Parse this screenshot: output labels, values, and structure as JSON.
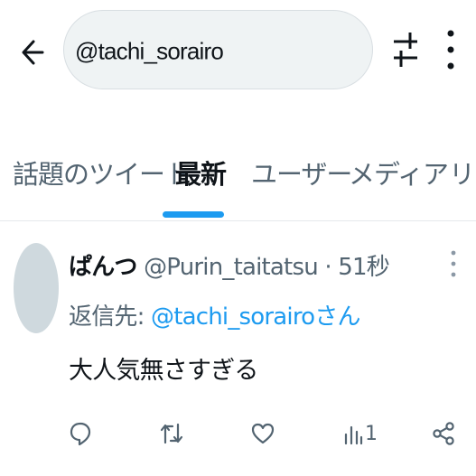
{
  "search": {
    "query": "@tachi_sorairo"
  },
  "tabs": [
    {
      "label": "話題のツイート"
    },
    {
      "label": "最新"
    },
    {
      "label": "ユーザー"
    },
    {
      "label": "メディア"
    },
    {
      "label": "リスト"
    }
  ],
  "tweet": {
    "display_name": "ぱんつ",
    "handle": "@Purin_taitatsu",
    "time": "· 51秒",
    "reply_prefix": "返信先: ",
    "reply_mention": "@tachi_sorairo",
    "reply_suffix": "さん",
    "text": "大人気無さすぎる",
    "views_count": "1"
  },
  "colors": {
    "accent": "#1d9bf0",
    "muted": "#536471",
    "text": "#0f1419",
    "avatar": "#cfd9de"
  }
}
